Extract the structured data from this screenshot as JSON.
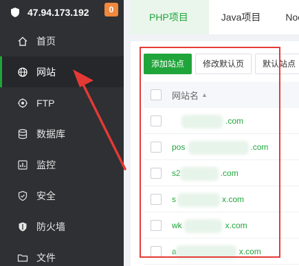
{
  "server": {
    "ip": "47.94.173.192",
    "badge": "0"
  },
  "sidebar": {
    "items": [
      {
        "label": "首页",
        "icon": "home-icon"
      },
      {
        "label": "网站",
        "icon": "globe-icon",
        "active": true
      },
      {
        "label": "FTP",
        "icon": "ftp-icon"
      },
      {
        "label": "数据库",
        "icon": "database-icon"
      },
      {
        "label": "监控",
        "icon": "monitor-icon"
      },
      {
        "label": "安全",
        "icon": "security-icon"
      },
      {
        "label": "防火墙",
        "icon": "firewall-icon"
      },
      {
        "label": "文件",
        "icon": "folder-icon"
      }
    ]
  },
  "tabs": [
    {
      "label": "PHP项目",
      "active": true
    },
    {
      "label": "Java项目"
    },
    {
      "label": "Noc"
    }
  ],
  "toolbar": {
    "add_site": "添加站点",
    "edit_default_page": "修改默认页",
    "default_site": "默认站点"
  },
  "table": {
    "header": {
      "site_name": "网站名",
      "sort_icon": "▲"
    },
    "rows": [
      {
        "prefix": "",
        "suffix": ".com"
      },
      {
        "prefix": "pos",
        "suffix": ".com"
      },
      {
        "prefix": "s2",
        "suffix": ".com"
      },
      {
        "prefix": "s",
        "suffix": "x.com"
      },
      {
        "prefix": "wk",
        "suffix": "x.com"
      },
      {
        "prefix": "a",
        "suffix": "x.com"
      }
    ]
  },
  "colors": {
    "accent": "#20a53a",
    "annotation": "#e53935",
    "sidebar_bg": "#2f3033",
    "badge": "#f0883d"
  }
}
